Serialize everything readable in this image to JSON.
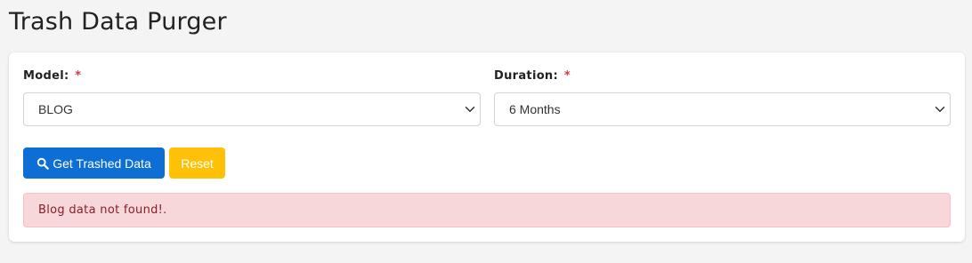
{
  "page": {
    "title": "Trash Data Purger"
  },
  "form": {
    "model": {
      "label": "Model:",
      "required_mark": "*",
      "selected": "BLOG"
    },
    "duration": {
      "label": "Duration:",
      "required_mark": "*",
      "selected": "6 Months"
    }
  },
  "actions": {
    "get_label": "Get Trashed Data",
    "get_icon": "search-icon",
    "reset_label": "Reset"
  },
  "alert": {
    "message": "Blog data not found!."
  },
  "colors": {
    "primary": "#0d6fd6",
    "warning": "#ffc107",
    "danger_bg": "#f8d7da",
    "danger_text": "#842029",
    "required": "#dc3545"
  }
}
